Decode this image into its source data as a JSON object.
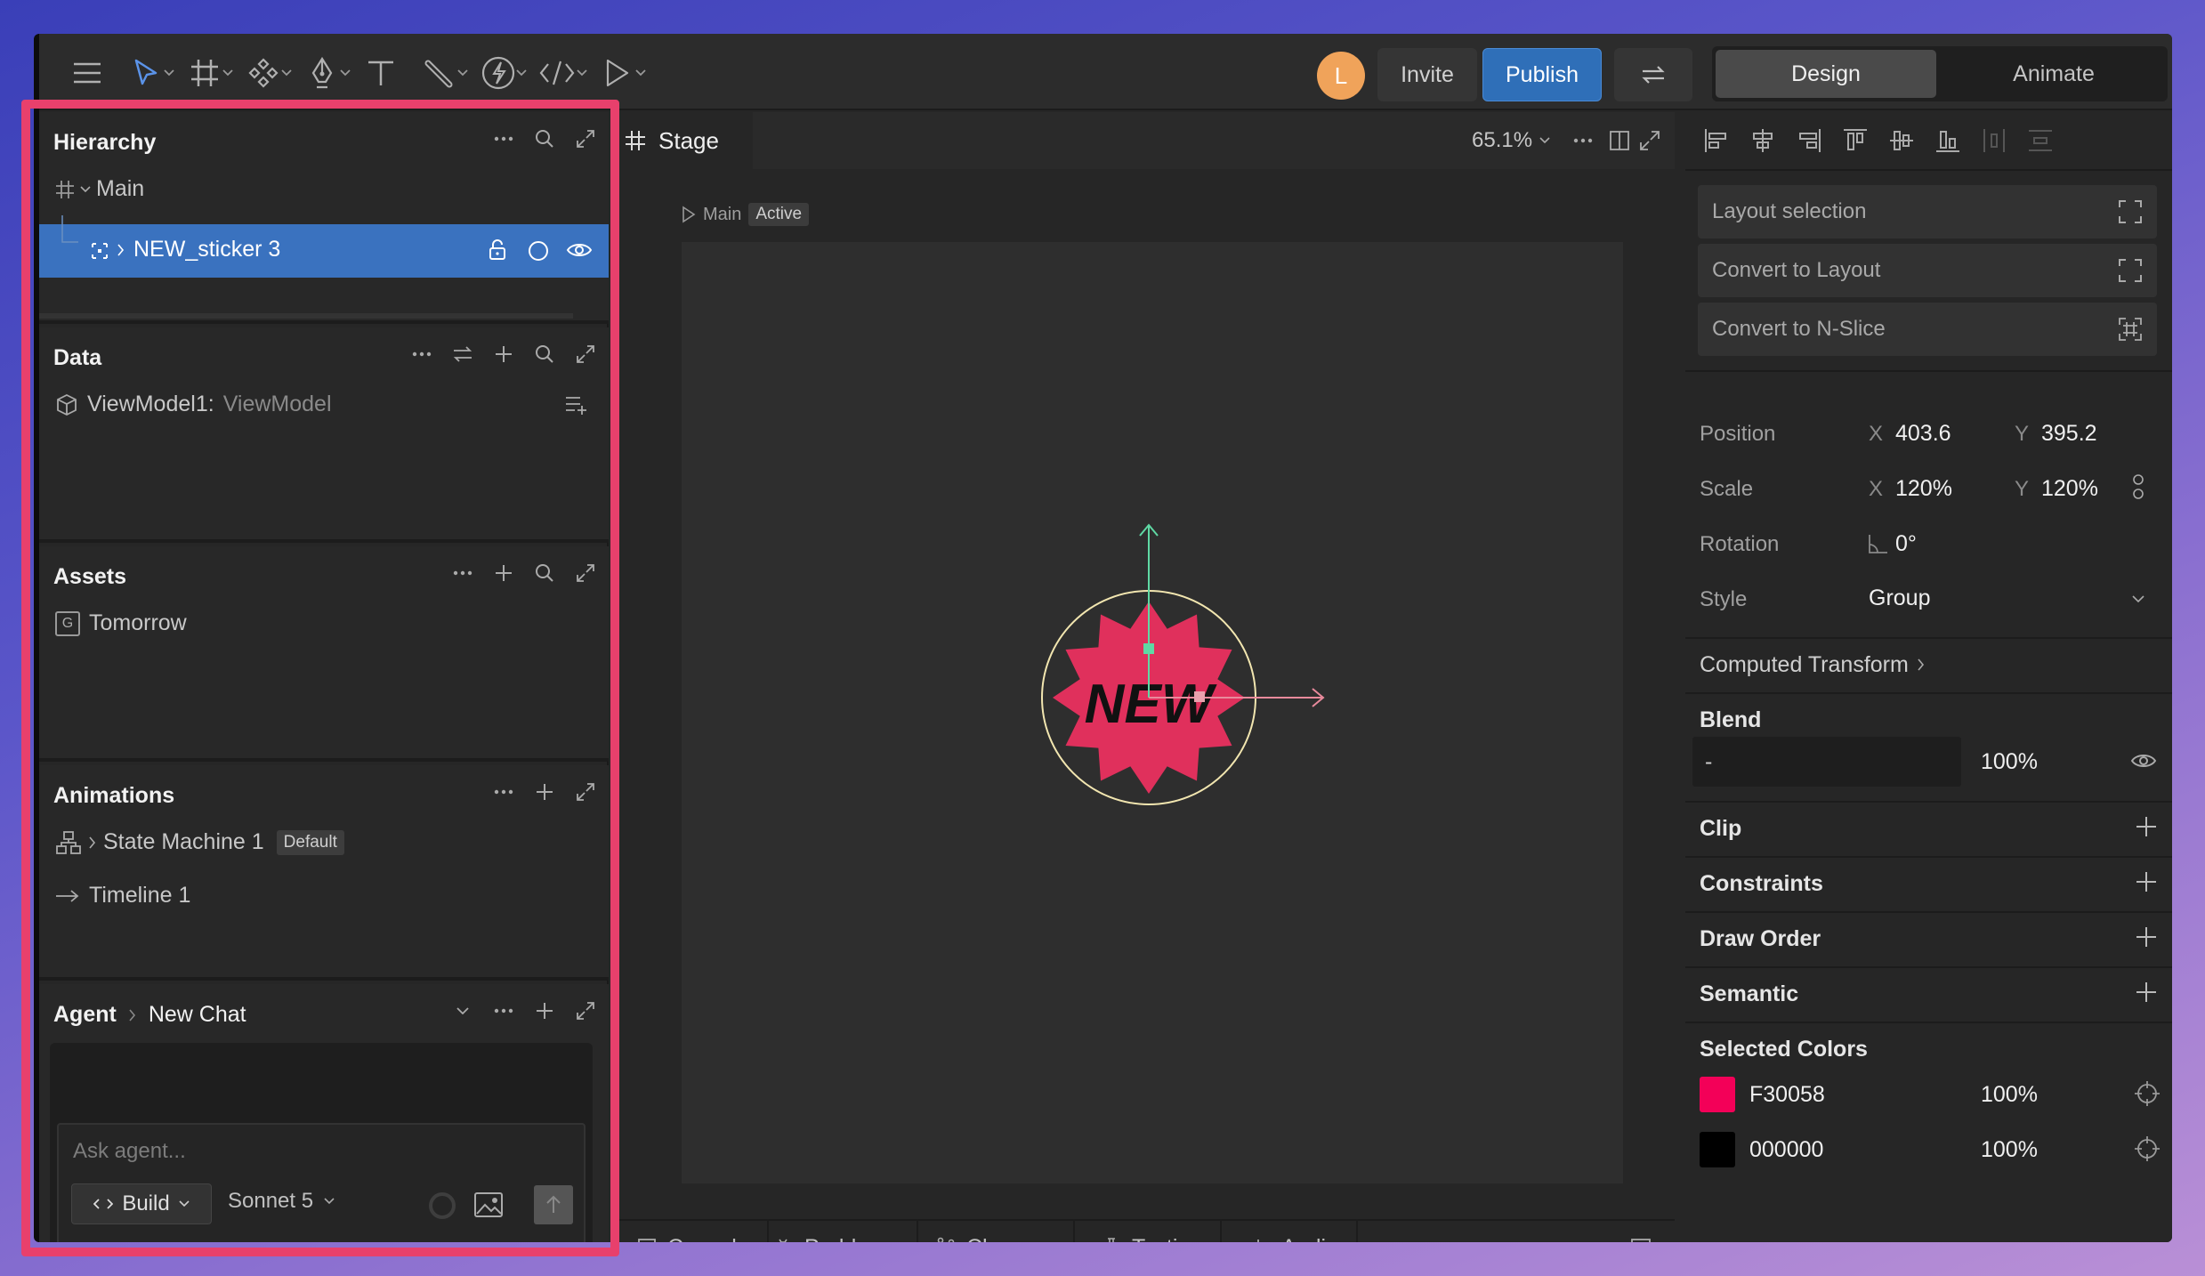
{
  "toolbar": {
    "avatar_initial": "L",
    "invite_label": "Invite",
    "publish_label": "Publish",
    "mode_tabs": [
      "Design",
      "Animate"
    ]
  },
  "hierarchy": {
    "title": "Hierarchy",
    "root": "Main",
    "selected_item": "NEW_sticker 3"
  },
  "data_panel": {
    "title": "Data",
    "viewmodel_name": "ViewModel1:",
    "viewmodel_type": "ViewModel"
  },
  "assets": {
    "title": "Assets",
    "items": [
      "Tomorrow"
    ],
    "font_badge": "G"
  },
  "animations": {
    "title": "Animations",
    "state_machine": "State Machine 1",
    "state_machine_badge": "Default",
    "timeline": "Timeline 1"
  },
  "agent": {
    "title": "Agent",
    "chat_name": "New Chat",
    "input_placeholder": "Ask agent...",
    "mode": "Build",
    "model": "Sonnet 5"
  },
  "stage": {
    "tab_label": "Stage",
    "zoom": "65.1%",
    "breadcrumb_root": "Main",
    "breadcrumb_state": "Active",
    "sticker_text": "NEW",
    "sticker_color": "#e0305c"
  },
  "bottom_tabs": [
    "Console",
    "Problems",
    "Changes",
    "Testing",
    "Audio"
  ],
  "design": {
    "layout_selection": "Layout selection",
    "convert_layout": "Convert to Layout",
    "convert_nslice": "Convert to N-Slice",
    "position_label": "Position",
    "pos_x": "403.6",
    "pos_y": "395.2",
    "scale_label": "Scale",
    "scale_x": "120%",
    "scale_y": "120%",
    "rotation_label": "Rotation",
    "rotation": "0°",
    "style_label": "Style",
    "style_value": "Group",
    "computed_transform": "Computed Transform",
    "blend_label": "Blend",
    "blend_mode": "-",
    "blend_opacity": "100%",
    "clip": "Clip",
    "constraints": "Constraints",
    "draw_order": "Draw Order",
    "semantic": "Semantic",
    "selected_colors_label": "Selected Colors",
    "x_key": "X",
    "y_key": "Y",
    "colors": [
      {
        "hex": "F30058",
        "swatch": "#F30058",
        "opacity": "100%"
      },
      {
        "hex": "000000",
        "swatch": "#000000",
        "opacity": "100%"
      }
    ]
  }
}
